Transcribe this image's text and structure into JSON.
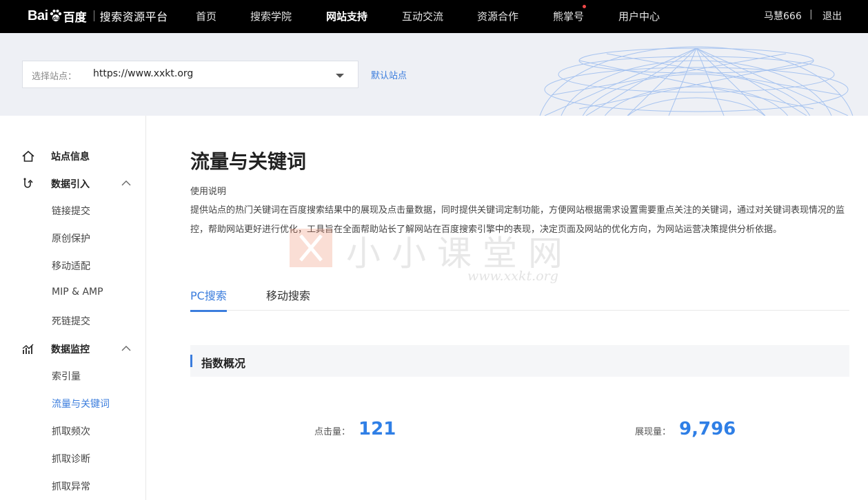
{
  "brand": {
    "logo_bai": "Bai",
    "logo_du": "百度",
    "subtitle": "搜索资源平台"
  },
  "nav": {
    "items": [
      {
        "label": "首页"
      },
      {
        "label": "搜索学院"
      },
      {
        "label": "网站支持",
        "active": true
      },
      {
        "label": "互动交流"
      },
      {
        "label": "资源合作"
      },
      {
        "label": "熊掌号",
        "badge": "red-dot"
      },
      {
        "label": "用户中心"
      }
    ],
    "username": "马慧666",
    "separator": "|",
    "logout": "退出"
  },
  "site_selector": {
    "label": "选择站点：",
    "value": "https://www.xxkt.org",
    "default_link": "默认站点"
  },
  "sidebar": {
    "groups": [
      {
        "label": "站点信息",
        "icon": "home-icon"
      },
      {
        "label": "数据引入",
        "icon": "data-import-icon",
        "expanded": true,
        "items": [
          "链接提交",
          "原创保护",
          "移动适配",
          "MIP & AMP",
          "死链提交"
        ]
      },
      {
        "label": "数据监控",
        "icon": "chart-icon",
        "expanded": true,
        "items": [
          "索引量",
          "流量与关键词",
          "抓取频次",
          "抓取诊断",
          "抓取异常"
        ]
      }
    ],
    "active_item": "流量与关键词"
  },
  "main": {
    "title": "流量与关键词",
    "desc_title": "使用说明",
    "description": "提供站点的热门关键词在百度搜索结果中的展现及点击量数据，同时提供关键词定制功能，方便网站根据需求设置需要重点关注的关键词，通过对关键词表现情况的监控，帮助网站更好进行优化，工具旨在全面帮助站长了解网站在百度搜索引擎中的表现，决定页面及网站的优化方向，为网站运营决策提供分析依据。",
    "tabs": [
      {
        "label": "PC搜索",
        "active": true
      },
      {
        "label": "移动搜索"
      }
    ],
    "section_title": "指数概况",
    "metrics": [
      {
        "label": "点击量：",
        "value": "121"
      },
      {
        "label": "展现量：",
        "value": "9,796"
      }
    ]
  },
  "watermark": {
    "text": "小小课堂网",
    "url": "www.xxkt.org"
  },
  "colors": {
    "accent": "#3b7ddd",
    "metric": "#2f7fe6",
    "topbar": "#000000",
    "badge": "#f04848"
  }
}
